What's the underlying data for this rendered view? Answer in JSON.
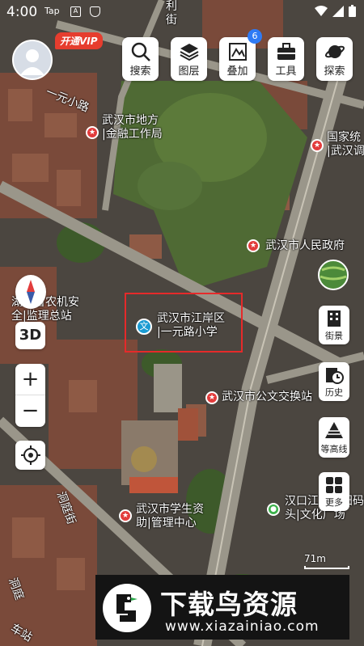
{
  "status_bar": {
    "time": "4:00",
    "app_tag": "Tap",
    "sq1": "A"
  },
  "vip_badge": "开通VIP",
  "toolbar": [
    {
      "label": "搜索",
      "icon": "search-icon"
    },
    {
      "label": "图层",
      "icon": "layers-icon"
    },
    {
      "label": "叠加",
      "icon": "overlay-icon",
      "badge": "6"
    },
    {
      "label": "工具",
      "icon": "toolbox-icon"
    },
    {
      "label": "探索",
      "icon": "planet-icon"
    }
  ],
  "map_labels": {
    "road_1": "一元小路",
    "road_2": "利街",
    "road_3": "洞庭街",
    "road_4": "洞庭",
    "road_5": "车站",
    "finance": [
      "武汉市地方",
      "|金融工作局"
    ],
    "national": [
      "国家统",
      "|武汉调"
    ],
    "gov": "武汉市人民政府",
    "agri": [
      "湖北省农机安",
      "全|监理总站"
    ],
    "school": [
      "武汉市江岸区",
      "|一元路小学"
    ],
    "exchange": "武汉市公文交换站",
    "student": [
      "武汉市学生资",
      "助|管理中心"
    ],
    "hankou": [
      "汉口江滩三阳码",
      "头|文化广场"
    ]
  },
  "left_controls": {
    "compass": "compass-icon",
    "mode_3d": "3D",
    "zoom_in": "+",
    "zoom_out": "−"
  },
  "right_controls": [
    {
      "label": "街景",
      "icon": "street-view-icon"
    },
    {
      "label": "历史",
      "icon": "history-icon"
    },
    {
      "label": "等高线",
      "icon": "contour-icon"
    },
    {
      "label": "更多",
      "icon": "more-grid-icon"
    }
  ],
  "scale": "71m",
  "watermark": {
    "title": "下载鸟资源",
    "url": "www.xiazainiao.com"
  },
  "colors": {
    "vip": "#e63d2e",
    "badge": "#2f7bf5",
    "select_box": "#e52a2a",
    "banner_bg": "#141414"
  }
}
